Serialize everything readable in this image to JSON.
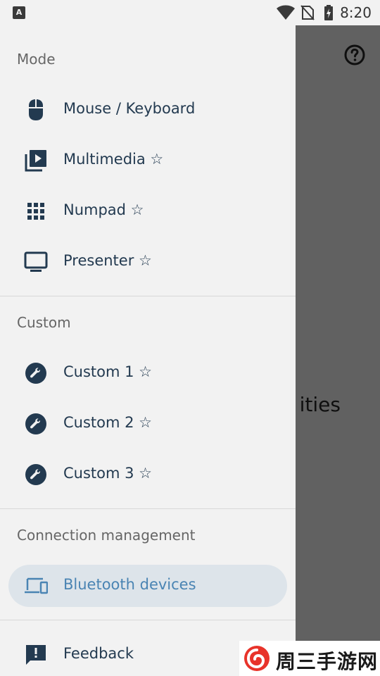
{
  "status_bar": {
    "time": "8:20",
    "left_icon_label": "A",
    "icons": [
      "wifi-icon",
      "no-sim-icon",
      "battery-charging-icon"
    ]
  },
  "underlay": {
    "partial_text": "ities",
    "help_icon": "help-circle-icon"
  },
  "drawer": {
    "sections": {
      "mode": {
        "header": "Mode",
        "items": [
          {
            "label": "Mouse / Keyboard",
            "icon": "mouse-icon"
          },
          {
            "label": "Multimedia ☆",
            "icon": "video-library-icon"
          },
          {
            "label": "Numpad ☆",
            "icon": "dialpad-icon"
          },
          {
            "label": "Presenter ☆",
            "icon": "monitor-icon"
          }
        ]
      },
      "custom": {
        "header": "Custom",
        "items": [
          {
            "label": "Custom 1 ☆",
            "icon": "wrench-icon"
          },
          {
            "label": "Custom 2 ☆",
            "icon": "wrench-icon"
          },
          {
            "label": "Custom 3 ☆",
            "icon": "wrench-icon"
          }
        ]
      },
      "connection": {
        "header": "Connection management",
        "items": [
          {
            "label": "Bluetooth devices",
            "icon": "devices-icon",
            "selected": true
          }
        ]
      },
      "other": {
        "items": [
          {
            "label": "Feedback",
            "icon": "feedback-icon"
          }
        ]
      }
    }
  },
  "watermark": {
    "text": "周三手游网"
  },
  "colors": {
    "drawer_bg": "#f2f2f2",
    "icon_color": "#233a50",
    "selected_bg": "#dde4ea",
    "selected_text": "#4a84b3",
    "section_header": "#666666",
    "scrim": "rgba(0,0,0,0.6)"
  }
}
